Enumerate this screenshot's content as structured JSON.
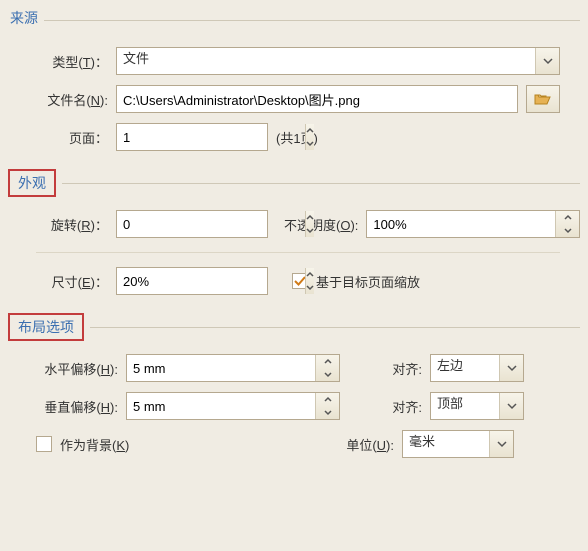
{
  "source": {
    "title": "来源",
    "type_label": "类型(T)：",
    "type_hotkey": "T",
    "type_value": "文件",
    "filename_label": "文件名(N):",
    "filename_hotkey": "N",
    "filename_value": "C:\\Users\\Administrator\\Desktop\\图片.png",
    "browse_icon": "open-folder-icon",
    "page_label": "页面：",
    "page_value": "1",
    "page_total": "(共1页)"
  },
  "appearance": {
    "title": "外观",
    "rotation_label": "旋转(R)：",
    "rotation_hotkey": "R",
    "rotation_value": "0",
    "opacity_label": "不透明度(O):",
    "opacity_hotkey": "O",
    "opacity_value": "100%",
    "size_label": "尺寸(E)：",
    "size_hotkey": "E",
    "size_value": "20%",
    "scale_to_target_checked": true,
    "scale_to_target_label": "基于目标页面缩放"
  },
  "layout": {
    "title": "布局选项",
    "h_offset_label": "水平偏移(H):",
    "h_offset_hotkey": "H",
    "h_offset_value": "5 mm",
    "h_align_label": "对齐:",
    "h_align_value": "左边",
    "v_offset_label": "垂直偏移(H):",
    "v_offset_hotkey": "H",
    "v_offset_value": "5 mm",
    "v_align_label": "对齐:",
    "v_align_value": "顶部",
    "as_background_checked": false,
    "as_background_label": "作为背景(K)",
    "as_background_hotkey": "K",
    "unit_label": "单位(U):",
    "unit_hotkey": "U",
    "unit_value": "毫米"
  }
}
